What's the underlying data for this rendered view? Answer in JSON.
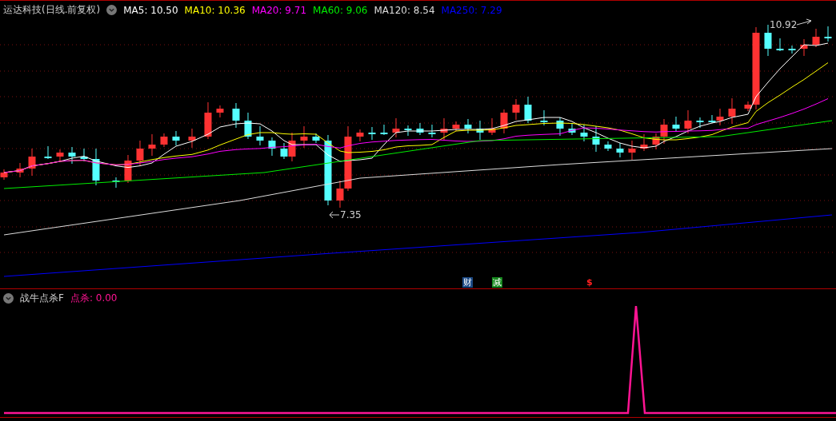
{
  "main_chart": {
    "title": "运达科技(日线.前复权)",
    "ma_legend": [
      {
        "label": "MA5: 10.50",
        "color": "#ffffff"
      },
      {
        "label": "MA10: 10.36",
        "color": "#ffff00"
      },
      {
        "label": "MA20: 9.71",
        "color": "#ff00ff"
      },
      {
        "label": "MA60: 9.06",
        "color": "#00ee00"
      },
      {
        "label": "MA120: 8.54",
        "color": "#dddddd"
      },
      {
        "label": "MA250: 7.29",
        "color": "#0000ff"
      }
    ],
    "high_label": "10.92",
    "low_label": "7.35",
    "signals": [
      {
        "kind": "badge",
        "text": "财",
        "color": "#1c4a86"
      },
      {
        "kind": "badge",
        "text": "减",
        "color": "#16881e"
      },
      {
        "kind": "mark",
        "text": "$",
        "color": "#ff2020"
      }
    ]
  },
  "indicator": {
    "title": "战牛点杀F",
    "reading": "点杀: 0.00"
  }
}
